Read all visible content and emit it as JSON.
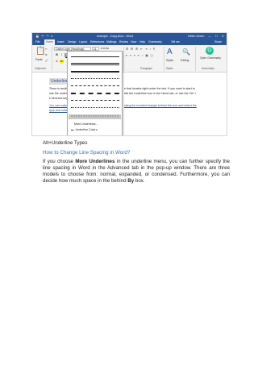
{
  "word": {
    "titlebar": {
      "doc_title": "example - Copy.docx  -  Word",
      "user": "Helen Green"
    },
    "tabs": [
      "File",
      "Home",
      "Insert",
      "Design",
      "Layout",
      "References",
      "Mailings",
      "Review",
      "View",
      "Help",
      "Grammarly",
      "Tell me",
      "Share"
    ],
    "ribbon": {
      "paste": "Paste",
      "font_name": "Calibri Light (Headings)",
      "font_size": "11",
      "styles": "Styles",
      "editing": "Editing",
      "open_grammarly": "Open Grammarly",
      "groups": [
        "Clipboard",
        "Font",
        "Paragraph",
        "Styles",
        "Grammarly"
      ]
    },
    "document": {
      "heading": "Underline",
      "line1_start": "There is another",
      "line1_end": "e that locates right under the text. If you want to start to",
      "line2_start": "use the underlin",
      "line2_end": "lick the Underline icon in the Home tab, or use the Ctrl +",
      "line3": "U shortcut key.",
      "line4_start": "You can customi",
      "line4_end": "cking the inverted triangle behind the icon and select the",
      "line5": "type and color y"
    },
    "underline_menu": {
      "more_underlines": "More Underlines...",
      "underline_color": "Underline Color"
    }
  },
  "page": {
    "caption": "Alt+Underline Types",
    "subheading": "How to Change Line Spacing in Word?",
    "para_1": "If you choose ",
    "para_bold_1": "More Underlines",
    "para_2": " in the underline menu, you can further specify the line spacing in Word in the Advanced tab in the pop-up window. There are three models to choose from: normal, expanded, or condensed. Furthermore, you can decide how much space in the behind ",
    "para_bold_2": "By",
    "para_3": " box."
  }
}
